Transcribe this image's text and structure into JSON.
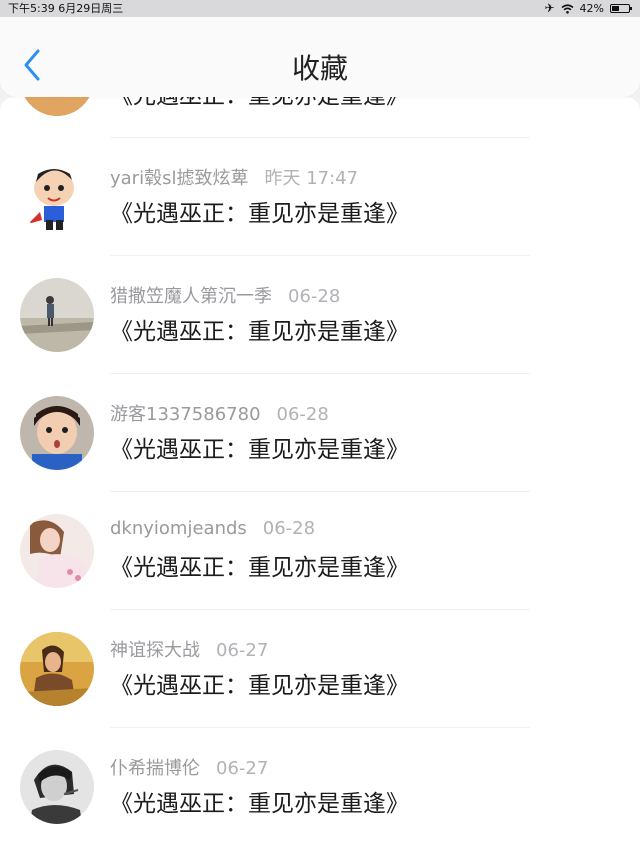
{
  "status_bar": {
    "time_date": "下午5:39   6月29日周三",
    "battery": "42%",
    "battery_level": 0.42,
    "icons": [
      "airplane-icon",
      "wifi-icon",
      "battery-icon"
    ]
  },
  "header": {
    "title": "收藏",
    "back_icon": "chevron-left-icon",
    "accent": "#2f8ff0"
  },
  "partial_row": {
    "content": "《光遇巫正：重见亦是重逢》"
  },
  "rows": [
    {
      "user": "yari毂sl摅致炫萆",
      "date": "昨天 17:47",
      "content": "《光遇巫正：重见亦是重逢》"
    },
    {
      "user": "猎撒笠魔人第沉一季",
      "date": "06-28",
      "content": "《光遇巫正：重见亦是重逢》"
    },
    {
      "user": "游客1337586780",
      "date": "06-28",
      "content": "《光遇巫正：重见亦是重逢》"
    },
    {
      "user": "dknyiomjeands",
      "date": "06-28",
      "content": "《光遇巫正：重见亦是重逢》"
    },
    {
      "user": "神谊探大战",
      "date": "06-27",
      "content": "《光遇巫正：重见亦是重逢》"
    },
    {
      "user": "仆希揣博伦",
      "date": "06-27",
      "content": "《光遇巫正：重见亦是重逢》"
    }
  ]
}
